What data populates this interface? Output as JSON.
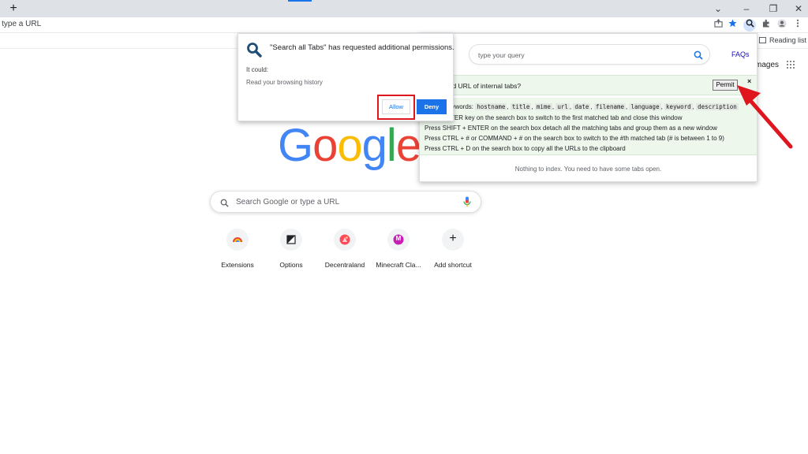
{
  "browser": {
    "new_tab_glyph": "+",
    "omnibox_text": "r type a URL",
    "reading_list_label": "Reading list",
    "window_controls": [
      "⌄",
      "–",
      "❐",
      "✕"
    ],
    "toolbar_icons": [
      "share-icon",
      "bookmark-star-icon",
      "search-all-tabs-icon",
      "extensions-puzzle-icon",
      "profile-icon",
      "more-menu-icon"
    ]
  },
  "ntp": {
    "images_link": "mages",
    "logo_letters": [
      {
        "ch": "G",
        "color": "#4285f4"
      },
      {
        "ch": "o",
        "color": "#ea4335"
      },
      {
        "ch": "o",
        "color": "#fbbc05"
      },
      {
        "ch": "g",
        "color": "#4285f4"
      },
      {
        "ch": "l",
        "color": "#34a853"
      },
      {
        "ch": "e",
        "color": "#ea4335"
      }
    ],
    "search_placeholder": "Search Google or type a URL",
    "shortcuts": [
      {
        "label": "Extensions",
        "icon": "chrome-rainbow-icon"
      },
      {
        "label": "Options",
        "icon": "options-square-icon"
      },
      {
        "label": "Decentraland",
        "icon": "decentraland-icon"
      },
      {
        "label": "Minecraft Cla...",
        "icon": "minecraft-m-icon",
        "letter": "M"
      },
      {
        "label": "Add shortcut",
        "icon": "plus-icon",
        "letter": "+"
      }
    ]
  },
  "permission_dialog": {
    "title": "\"Search all Tabs\" has requested additional permissions.",
    "it_could": "It could:",
    "permission": "Read your browsing history",
    "allow_label": "Allow",
    "deny_label": "Deny",
    "accent": "#1a73e8",
    "highlight": "#e0161f"
  },
  "extension_popup": {
    "search_placeholder": "type your query",
    "faqs_label": "FAQs",
    "permit_question": "and URL of internal tabs?",
    "permit_label": "Permit",
    "close_label": "×",
    "help": {
      "keywords_prefix": "keywords:",
      "keywords": [
        "hostname",
        "title",
        "mime",
        "url",
        "date",
        "filename",
        "language",
        "keyword",
        "description"
      ],
      "lines": [
        "TER key on the search box to switch to the first matched tab and close this window",
        "Press SHIFT + ENTER on the search box detach all the matching tabs and group them as a new window",
        "Press CTRL + # or COMMAND + # on the search box to switch to the #th matched tab (# is between 1 to 9)",
        "Press CTRL + D on the search box to copy all the URLs to the clipboard"
      ]
    },
    "empty_message": "Nothing to index. You need to have some tabs open."
  }
}
